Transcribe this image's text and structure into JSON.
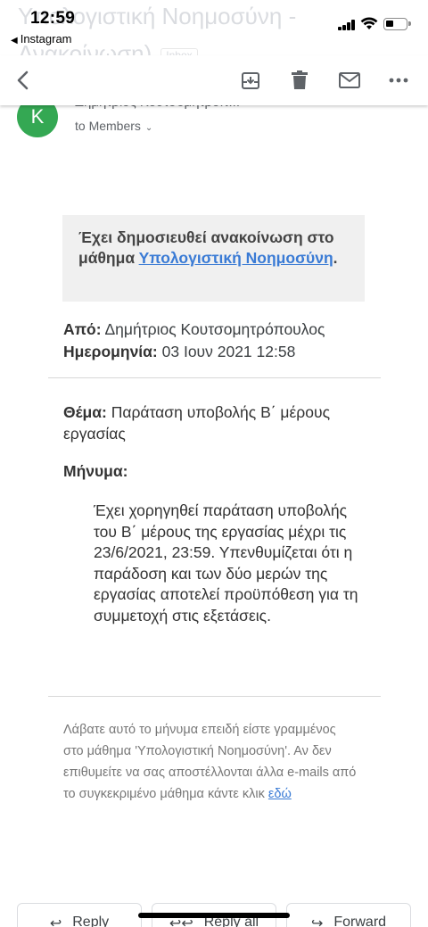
{
  "status_bar": {
    "time": "12:59",
    "back_app": "Instagram"
  },
  "ghost_header": {
    "line1": "Υπολογιστική Νοημοσύνη -",
    "line2": "Ανακοίνωση)",
    "label": "Inbox"
  },
  "toolbar": {
    "back_icon": "back-arrow-icon",
    "archive_icon": "archive-icon",
    "delete_icon": "trash-icon",
    "mark_unread_icon": "mail-icon",
    "more_icon": "more-horiz-icon"
  },
  "sender": {
    "avatar_letter": "K",
    "avatar_color": "#34a853",
    "name_partial": "Δημήτριος Κουτσομητρόπ...",
    "recipient": "to Members"
  },
  "announcement": {
    "prefix": "Έχει δημοσιευθεί ανακοίνωση στο μάθημα ",
    "course_link": "Υπολογιστική Νοημοσύνη",
    "suffix": "."
  },
  "meta": {
    "from_label": "Από:",
    "from_value": "Δημήτριος Κουτσομητρόπουλος",
    "date_label": "Ημερομηνία:",
    "date_value": "03 Ιουν 2021 12:58"
  },
  "subject": {
    "label": "Θέμα:",
    "value": "Παράταση υποβολής Β΄ μέρους εργασίας"
  },
  "message": {
    "label": "Μήνυμα:",
    "body": "Έχει χορηγηθεί παράταση υποβολής του Β΄ μέρους της εργασίας μέχρι τις 23/6/2021, 23:59. Υπενθυμίζεται ότι η παράδοση και των δύο μερών της εργασίας αποτελεί προϋπόθεση για τη συμμετοχή στις εξετάσεις."
  },
  "footer": {
    "text": "Λάβατε αυτό το μήνυμα επειδή είστε γραμμένος στο μάθημα 'Υπολογιστική Νοημοσύνη'. Αν δεν επιθυμείτε να σας αποστέλλονται άλλα e-mails από το συγκεκριμένο μάθημα κάντε κλικ ",
    "link": "εδώ"
  },
  "reply_bar": {
    "reply": "Reply",
    "reply_all": "Reply all",
    "forward": "Forward"
  },
  "colors": {
    "accent_link": "#3a7bd5",
    "box_bg": "#f0f0f0"
  }
}
